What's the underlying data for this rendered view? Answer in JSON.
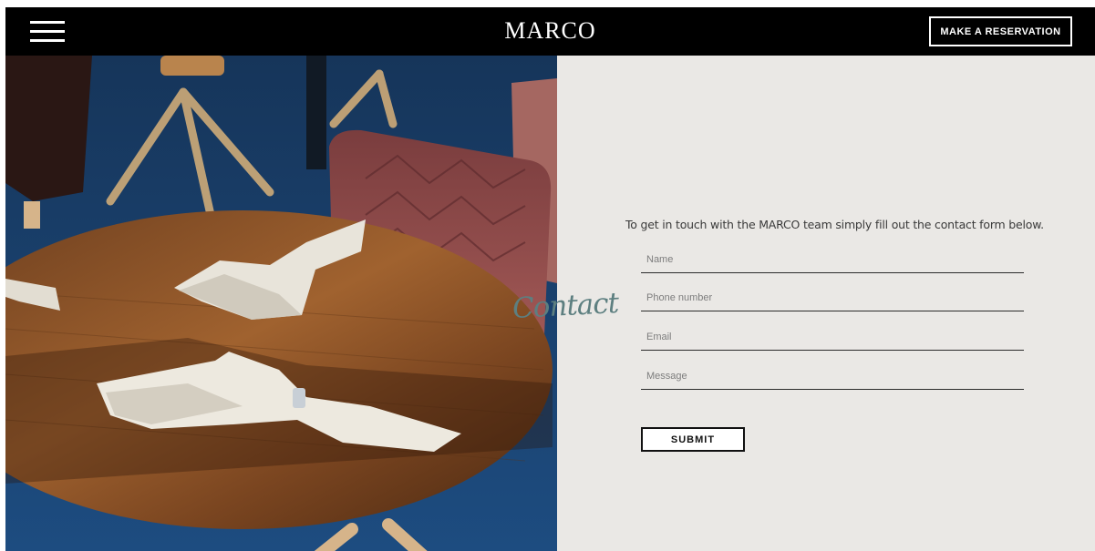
{
  "header": {
    "logo": "MARCO",
    "reservation_label": "MAKE A RESERVATION"
  },
  "hero": {
    "heading": "Contact"
  },
  "form": {
    "intro": "To get in touch with the MARCO team simply fill out the contact form below.",
    "fields": [
      {
        "placeholder": "Name"
      },
      {
        "placeholder": "Phone number"
      },
      {
        "placeholder": "Email"
      },
      {
        "placeholder": "Message"
      }
    ],
    "submit_label": "SUBMIT"
  },
  "colors": {
    "header_bg": "#000000",
    "panel_bg": "#eae8e5",
    "script_accent": "#5d7f80"
  },
  "icons": {
    "menu": "hamburger-icon"
  }
}
